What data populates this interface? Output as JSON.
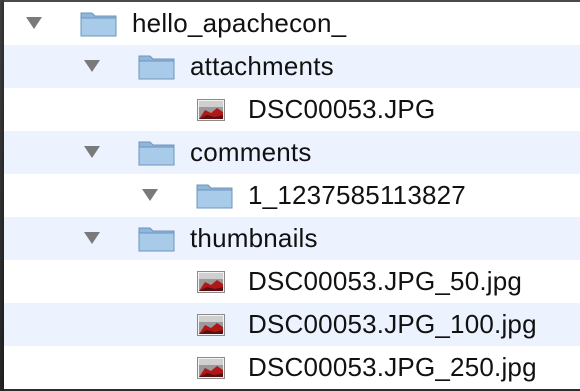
{
  "tree": {
    "items": [
      {
        "label": "hello_apachecon_",
        "icon": "folder-icon",
        "expanded": true
      },
      {
        "label": "attachments",
        "icon": "folder-icon",
        "expanded": true
      },
      {
        "label": "DSC00053.JPG",
        "icon": "image-file-icon"
      },
      {
        "label": "comments",
        "icon": "folder-icon",
        "expanded": true
      },
      {
        "label": "1_1237585113827",
        "icon": "folder-icon",
        "expanded": true
      },
      {
        "label": "thumbnails",
        "icon": "folder-icon",
        "expanded": true
      },
      {
        "label": "DSC00053.JPG_50.jpg",
        "icon": "image-file-icon"
      },
      {
        "label": "DSC00053.JPG_100.jpg",
        "icon": "image-file-icon"
      },
      {
        "label": "DSC00053.JPG_250.jpg",
        "icon": "image-file-icon"
      }
    ]
  },
  "colors": {
    "row_alt": "#edf3fe",
    "row_base": "#ffffff",
    "folder": "#9fc3e4",
    "disclosure": "#7a7a7a"
  }
}
